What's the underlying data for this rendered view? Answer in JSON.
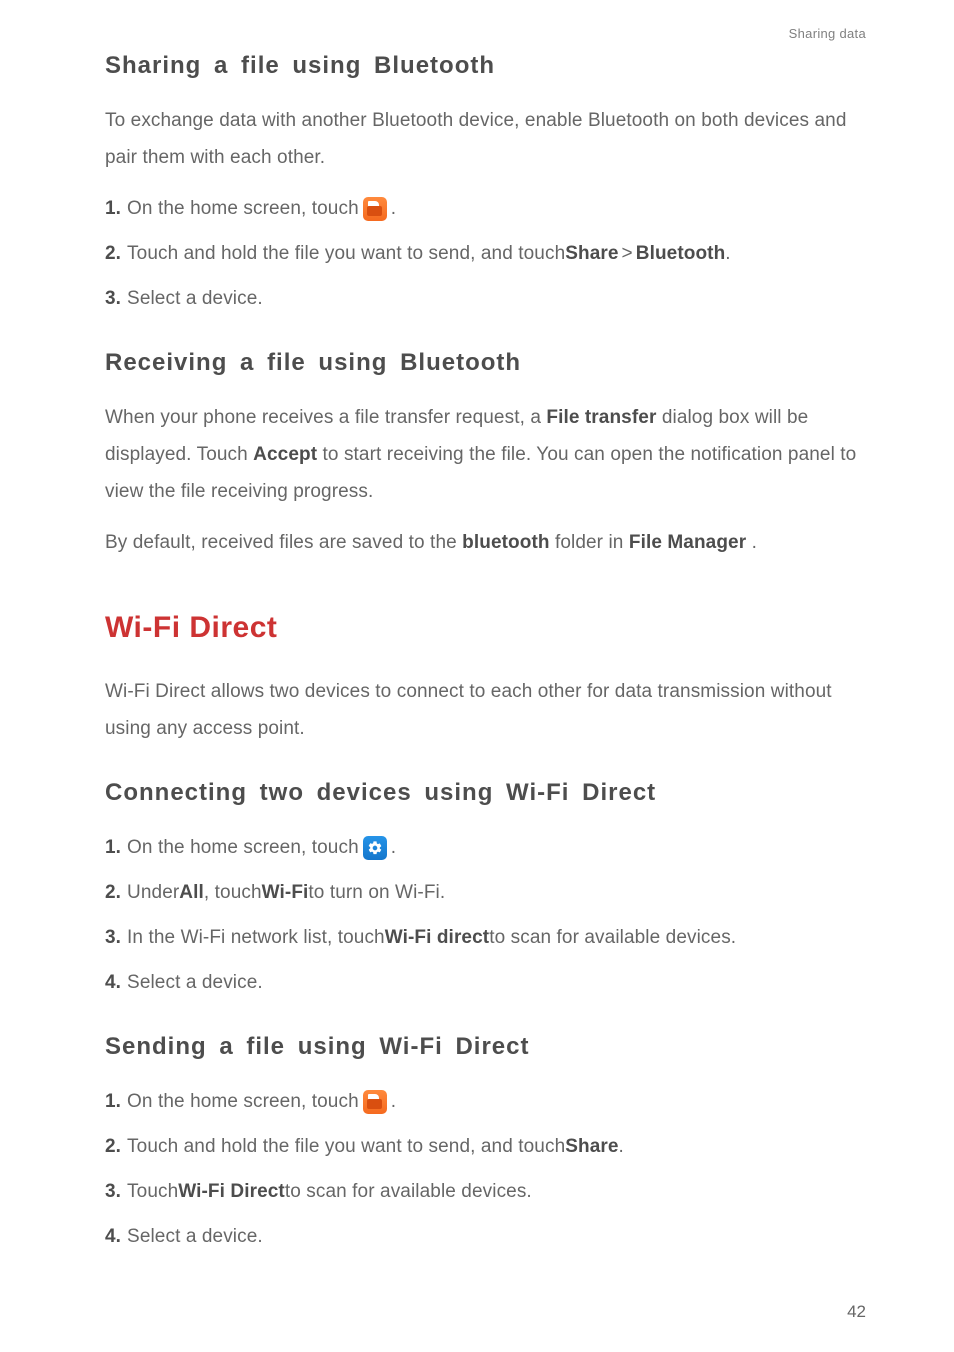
{
  "header": {
    "section": "Sharing data"
  },
  "sec1": {
    "title": "Sharing a file using Bluetooth",
    "intro": "To exchange data with another Bluetooth device, enable Bluetooth on both devices and pair them with each other.",
    "s1": {
      "num": "1.",
      "a": "On the home screen, touch",
      "b": "."
    },
    "s2": {
      "num": "2.",
      "a": "Touch and hold the file you want to send, and touch ",
      "share": "Share",
      "gt": " > ",
      "bt": "Bluetooth",
      "end": "."
    },
    "s3": {
      "num": "3.",
      "a": "Select a device."
    }
  },
  "sec2": {
    "title": "Receiving a file using Bluetooth",
    "p1a": "When your phone receives a file transfer request, a ",
    "ft": "File transfer",
    "p1b": " dialog box will be displayed. Touch ",
    "accept": "Accept",
    "p1c": " to start receiving the file. You can open the notification panel to view the file receiving progress.",
    "p2a": "By default, received files are saved to the ",
    "btfolder": "bluetooth",
    "p2b": " folder in ",
    "fm": "File Manager",
    "p2c": "."
  },
  "sec3": {
    "title": "Wi-Fi Direct",
    "intro": "Wi-Fi Direct allows two devices to connect to each other for data transmission without using any access point."
  },
  "sec4": {
    "title": "Connecting two devices using Wi-Fi Direct",
    "s1": {
      "num": "1.",
      "a": "On the home screen, touch",
      "b": "."
    },
    "s2": {
      "num": "2.",
      "a": "Under ",
      "all": "All",
      "b": ", touch ",
      "wifi": "Wi-Fi",
      "c": " to turn on Wi-Fi."
    },
    "s3": {
      "num": "3.",
      "a": "In the Wi-Fi network list, touch ",
      "wfd": "Wi-Fi direct",
      "b": " to scan for available devices."
    },
    "s4": {
      "num": "4.",
      "a": "Select a device."
    }
  },
  "sec5": {
    "title": "Sending a file using Wi-Fi Direct",
    "s1": {
      "num": "1.",
      "a": "On the home screen, touch",
      "b": "."
    },
    "s2": {
      "num": "2.",
      "a": "Touch and hold the file you want to send, and touch ",
      "share": "Share",
      "end": "."
    },
    "s3": {
      "num": "3.",
      "a": "Touch ",
      "wfd": "Wi-Fi Direct",
      "b": " to scan for available devices."
    },
    "s4": {
      "num": "4.",
      "a": "Select a device."
    }
  },
  "page": "42"
}
